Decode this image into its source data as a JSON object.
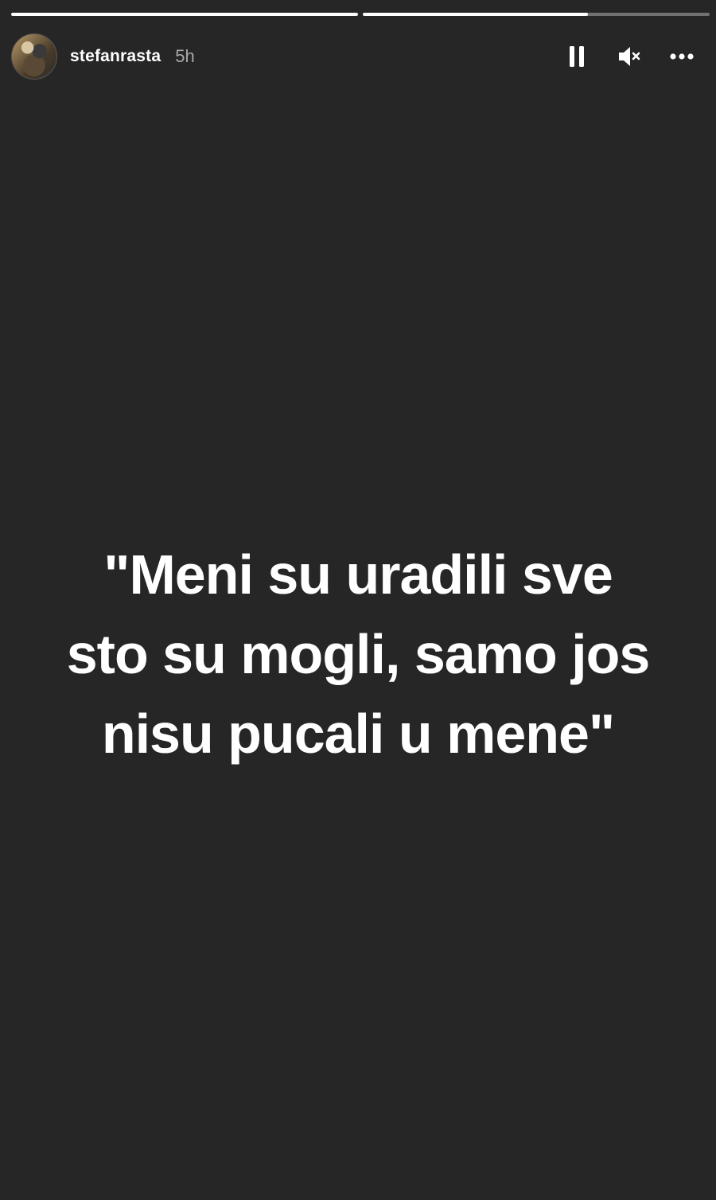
{
  "story": {
    "progress": [
      1.0,
      0.65
    ],
    "username": "stefanrasta",
    "timestamp": "5h",
    "text_lines": [
      "\"Meni su uradili sve",
      "sto su mogli, samo jos",
      "nisu pucali u mene\""
    ]
  },
  "controls": {
    "pause_icon": "pause-icon",
    "mute_icon": "speaker-muted-icon",
    "more_icon": "more-horizontal-icon"
  },
  "colors": {
    "background": "#262626",
    "text": "#ffffff",
    "muted_text": "#a8a8a8"
  }
}
